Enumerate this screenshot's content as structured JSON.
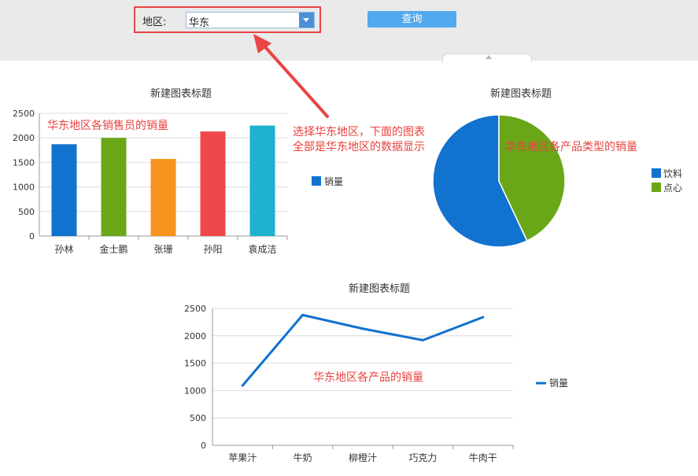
{
  "filter": {
    "label": "地区:",
    "selected": "华东",
    "query_label": "查询"
  },
  "annotations": {
    "bar_note": "华东地区各销售员的销量",
    "center_note_line1": "选择华东地区，下面的图表",
    "center_note_line2": "全部是华东地区的数据显示",
    "pie_note": "华东地区各产品类型的销量",
    "line_note": "华东地区各产品的销量"
  },
  "colors": {
    "accent_blue": "#1172cf",
    "annotation_red": "#e8423d",
    "query_button": "#53a9ee"
  },
  "chart_data": [
    {
      "type": "bar",
      "title": "新建图表标题",
      "categories": [
        "孙林",
        "金士鹏",
        "张珊",
        "孙阳",
        "袁成洁"
      ],
      "series": [
        {
          "name": "销量",
          "values": [
            1870,
            2000,
            1570,
            2130,
            2250
          ]
        }
      ],
      "bar_colors": [
        "#1172cf",
        "#6aa718",
        "#f7941d",
        "#f0474c",
        "#1fb1cf"
      ],
      "yticks": [
        0,
        500,
        1000,
        1500,
        2000,
        2500
      ],
      "ylim": [
        0,
        2500
      ],
      "grid": true,
      "legend": "right"
    },
    {
      "type": "pie",
      "title": "新建图表标题",
      "labels": [
        "饮料",
        "点心"
      ],
      "values": [
        57,
        43
      ],
      "colors": [
        "#1172cf",
        "#6aa718"
      ],
      "legend": "right"
    },
    {
      "type": "line",
      "title": "新建图表标题",
      "categories": [
        "苹果汁",
        "牛奶",
        "柳橙汁",
        "巧克力",
        "牛肉干"
      ],
      "series": [
        {
          "name": "销量",
          "values": [
            1090,
            2380,
            2130,
            1920,
            2340
          ]
        }
      ],
      "color": "#1172cf",
      "yticks": [
        0,
        500,
        1000,
        1500,
        2000,
        2500
      ],
      "ylim": [
        0,
        2500
      ],
      "grid": true,
      "legend": "right"
    }
  ]
}
